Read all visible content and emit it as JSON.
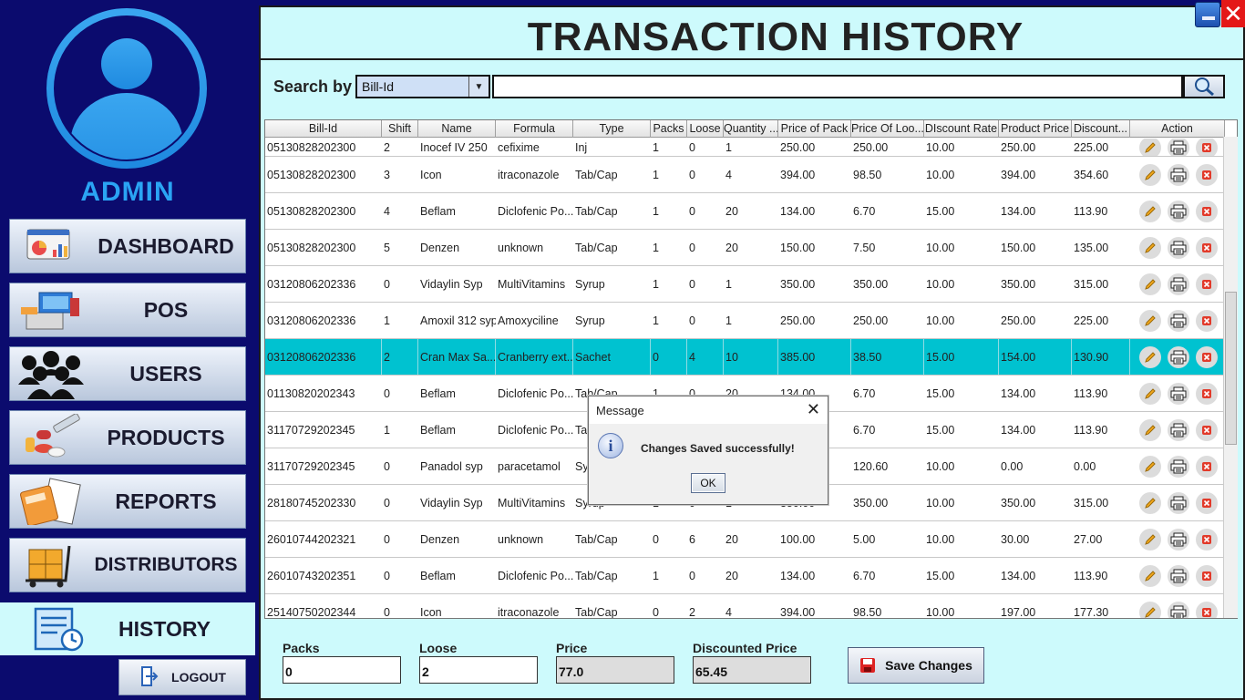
{
  "sidebar": {
    "admin_label": "ADMIN",
    "nav": [
      {
        "label": "DASHBOARD",
        "icon": "dashboard-chart-icon"
      },
      {
        "label": "POS",
        "icon": "cash-register-icon"
      },
      {
        "label": "USERS",
        "icon": "users-group-icon"
      },
      {
        "label": "PRODUCTS",
        "icon": "medicine-products-icon"
      },
      {
        "label": "REPORTS",
        "icon": "calculator-report-icon"
      },
      {
        "label": "DISTRIBUTORS",
        "icon": "hand-truck-icon"
      },
      {
        "label": "HISTORY",
        "icon": "receipt-clock-icon"
      }
    ],
    "logout_label": "LOGOUT"
  },
  "header": {
    "title": "TRANSACTION HISTORY"
  },
  "search": {
    "label": "Search by",
    "selected": "Bill-Id",
    "value": ""
  },
  "table": {
    "columns": [
      "Bill-Id",
      "Shift",
      "Name",
      "Formula",
      "Type",
      "Packs",
      "Loose",
      "Quantity ...",
      "Price of Pack",
      "Price Of Loo...",
      "DIscount Rate",
      "Product Price",
      "Discount...",
      "Action"
    ],
    "rows": [
      [
        "05130828202300",
        "2",
        "Inocef IV 250",
        "cefixime",
        "Inj",
        "1",
        "0",
        "1",
        "250.00",
        "250.00",
        "10.00",
        "250.00",
        "225.00"
      ],
      [
        "05130828202300",
        "3",
        "Icon",
        "itraconazole",
        "Tab/Cap",
        "1",
        "0",
        "4",
        "394.00",
        "98.50",
        "10.00",
        "394.00",
        "354.60"
      ],
      [
        "05130828202300",
        "4",
        "Beflam",
        "Diclofenic Po...",
        "Tab/Cap",
        "1",
        "0",
        "20",
        "134.00",
        "6.70",
        "15.00",
        "134.00",
        "113.90"
      ],
      [
        "05130828202300",
        "5",
        "Denzen",
        "unknown",
        "Tab/Cap",
        "1",
        "0",
        "20",
        "150.00",
        "7.50",
        "10.00",
        "150.00",
        "135.00"
      ],
      [
        "03120806202336",
        "0",
        "Vidaylin Syp",
        "MultiVitamins",
        "Syrup",
        "1",
        "0",
        "1",
        "350.00",
        "350.00",
        "10.00",
        "350.00",
        "315.00"
      ],
      [
        "03120806202336",
        "1",
        "Amoxil 312 syp",
        "Amoxyciline",
        "Syrup",
        "1",
        "0",
        "1",
        "250.00",
        "250.00",
        "10.00",
        "250.00",
        "225.00"
      ],
      [
        "03120806202336",
        "2",
        "Cran Max Sa...",
        "Cranberry ext...",
        "Sachet",
        "0",
        "4",
        "10",
        "385.00",
        "38.50",
        "15.00",
        "154.00",
        "130.90"
      ],
      [
        "01130820202343",
        "0",
        "Beflam",
        "Diclofenic Po...",
        "Tab/Cap",
        "1",
        "0",
        "20",
        "134.00",
        "6.70",
        "15.00",
        "134.00",
        "113.90"
      ],
      [
        "31170729202345",
        "1",
        "Beflam",
        "Diclofenic Po...",
        "Tab/Cap",
        "1",
        "0",
        "20",
        "134.00",
        "6.70",
        "15.00",
        "134.00",
        "113.90"
      ],
      [
        "31170729202345",
        "0",
        "Panadol syp",
        "paracetamol",
        "Syrup",
        "0",
        "0",
        "1",
        "120.60",
        "120.60",
        "10.00",
        "0.00",
        "0.00"
      ],
      [
        "28180745202330",
        "0",
        "Vidaylin Syp",
        "MultiVitamins",
        "Syrup",
        "1",
        "0",
        "1",
        "350.00",
        "350.00",
        "10.00",
        "350.00",
        "315.00"
      ],
      [
        "26010744202321",
        "0",
        "Denzen",
        "unknown",
        "Tab/Cap",
        "0",
        "6",
        "20",
        "100.00",
        "5.00",
        "10.00",
        "30.00",
        "27.00"
      ],
      [
        "26010743202351",
        "0",
        "Beflam",
        "Diclofenic Po...",
        "Tab/Cap",
        "1",
        "0",
        "20",
        "134.00",
        "6.70",
        "15.00",
        "134.00",
        "113.90"
      ],
      [
        "25140750202344",
        "0",
        "Icon",
        "itraconazole",
        "Tab/Cap",
        "0",
        "2",
        "4",
        "394.00",
        "98.50",
        "10.00",
        "197.00",
        "177.30"
      ]
    ],
    "selected_row": 6,
    "actions": [
      "edit-icon",
      "print-icon",
      "delete-icon"
    ]
  },
  "form": {
    "packs_label": "Packs",
    "packs_value": "0",
    "loose_label": "Loose",
    "loose_value": "2",
    "price_label": "Price",
    "price_value": "77.0",
    "discounted_label": "Discounted Price",
    "discounted_value": "65.45",
    "save_label": "Save Changes"
  },
  "dialog": {
    "title": "Message",
    "message": "Changes Saved successfully!",
    "ok_label": "OK"
  },
  "colors": {
    "sidebar_bg": "#0b0b6e",
    "main_bg": "#cdfafc",
    "selected_row": "#00c2d0",
    "admin_text": "#2aa4f4"
  }
}
